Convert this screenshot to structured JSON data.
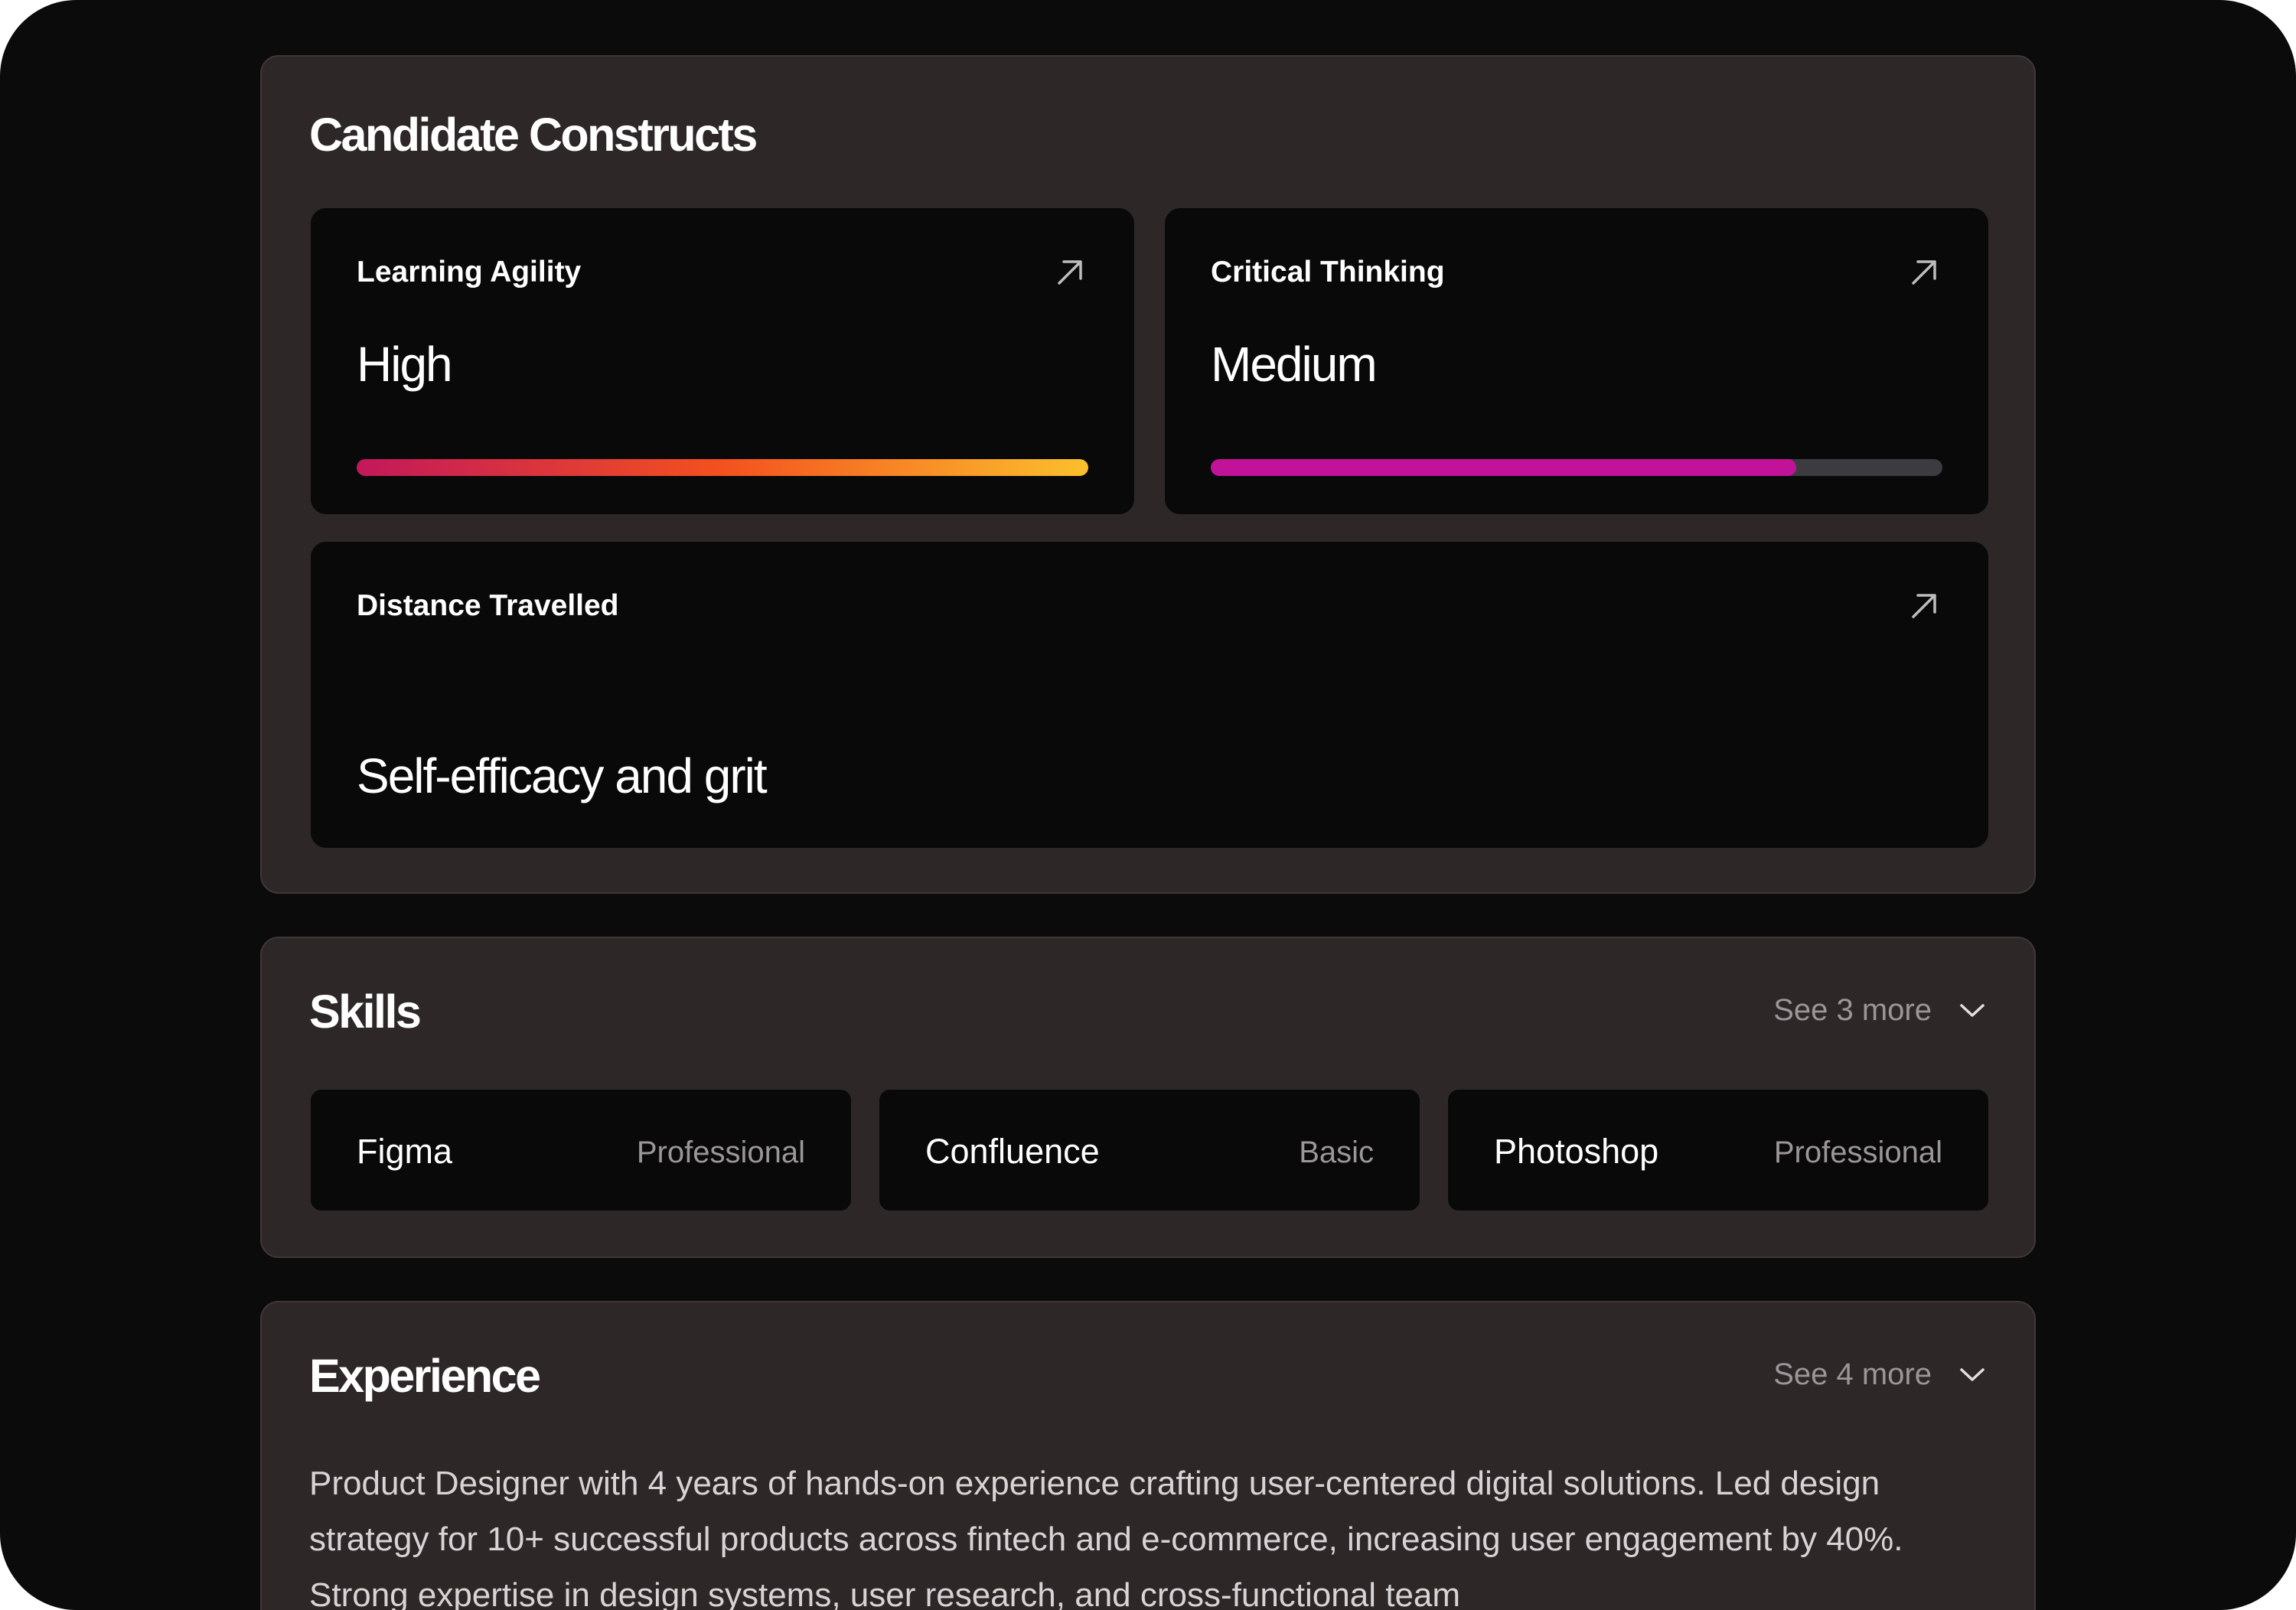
{
  "constructs": {
    "title": "Candidate Constructs",
    "cards": [
      {
        "label": "Learning Agility",
        "value": "High",
        "level": 1.0,
        "bar_colors": [
          "#c2185b",
          "#f4511e",
          "#fbc02d"
        ]
      },
      {
        "label": "Critical Thinking",
        "value": "Medium",
        "level": 0.8,
        "bar_colors": [
          "#c2129a",
          "#c2129a"
        ]
      },
      {
        "label": "Distance Travelled",
        "value": "Self-efficacy and grit"
      }
    ],
    "icon": "arrow-up-right-icon"
  },
  "skills": {
    "title": "Skills",
    "see_more": "See 3 more",
    "items": [
      {
        "name": "Figma",
        "level": "Professional"
      },
      {
        "name": "Confluence",
        "level": "Basic"
      },
      {
        "name": "Photoshop",
        "level": "Professional"
      }
    ]
  },
  "experience": {
    "title": "Experience",
    "see_more": "See 4 more",
    "text": "Product Designer with 4 years of hands-on experience crafting user-centered digital solutions. Led design strategy for 10+ successful products across fintech and e-commerce, increasing user engagement by 40%. Strong expertise in design systems, user research, and cross-functional team"
  },
  "colors": {
    "background": "#0b0b0b",
    "panel": "#2e2728",
    "card": "#090909",
    "muted_text": "#9b9698",
    "bar_track": "#3c3c40"
  }
}
